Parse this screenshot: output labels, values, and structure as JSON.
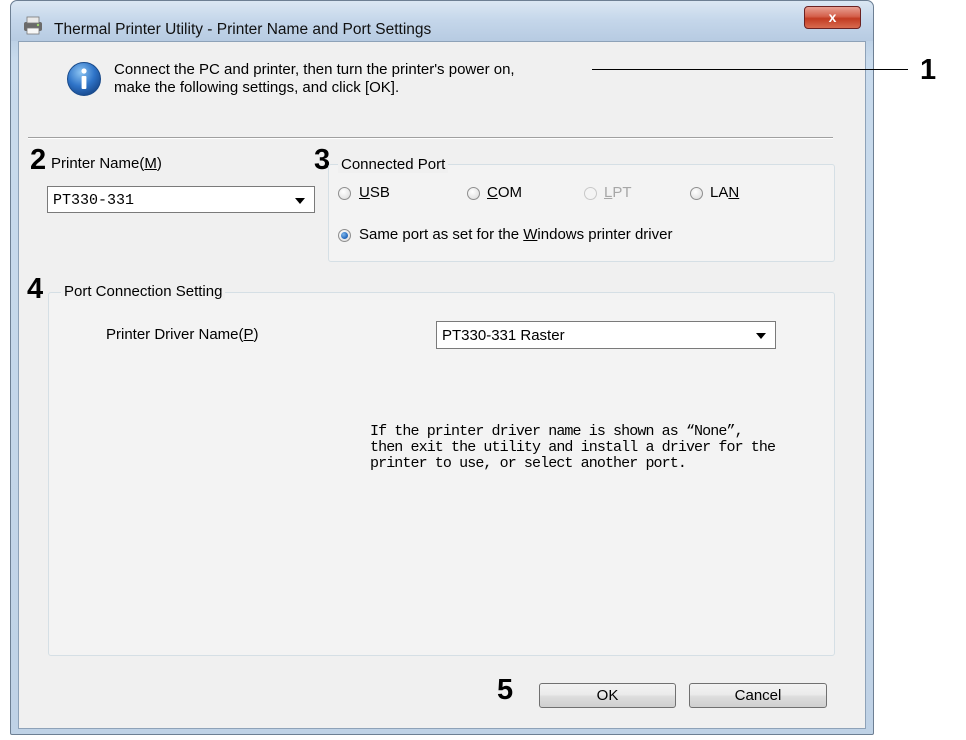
{
  "window": {
    "title": "Thermal Printer Utility - Printer Name and Port Settings",
    "close_symbol": "x"
  },
  "info": {
    "icon": "info-icon",
    "line1": "Connect the PC and printer, then turn the printer's power on,",
    "line2": "make the following settings, and click [OK]."
  },
  "callouts": {
    "c1": "1",
    "c2": "2",
    "c3": "3",
    "c4": "4",
    "c5": "5"
  },
  "printer_name": {
    "label_pre": "Printer Name(",
    "label_key": "M",
    "label_post": ")",
    "value": "PT330-331"
  },
  "connected_port": {
    "title": "Connected Port",
    "options": [
      {
        "pre": "",
        "key": "U",
        "post": "SB",
        "checked": false,
        "disabled": false
      },
      {
        "pre": "",
        "key": "C",
        "post": "OM",
        "checked": false,
        "disabled": false
      },
      {
        "pre": "",
        "key": "L",
        "post": "PT",
        "checked": false,
        "disabled": true
      },
      {
        "pre": "LA",
        "key": "N",
        "post": "",
        "checked": false,
        "disabled": false
      }
    ],
    "same_port": {
      "pre": "Same port as set for the ",
      "key": "W",
      "post": "indows printer driver",
      "checked": true
    }
  },
  "port_connection": {
    "title": "Port Connection Setting",
    "driver_label_pre": "Printer Driver Name(",
    "driver_label_key": "P",
    "driver_label_post": ")",
    "driver_value": "PT330-331 Raster",
    "note_line1": "If the printer driver name is shown as “None”,",
    "note_line2": "then exit the utility and install a driver for the",
    "note_line3": "printer to use, or select another port."
  },
  "buttons": {
    "ok": "OK",
    "cancel": "Cancel"
  },
  "colors": {
    "accent": "#2a6fc2",
    "close": "#c23b22",
    "frame": "#b8cde3"
  }
}
